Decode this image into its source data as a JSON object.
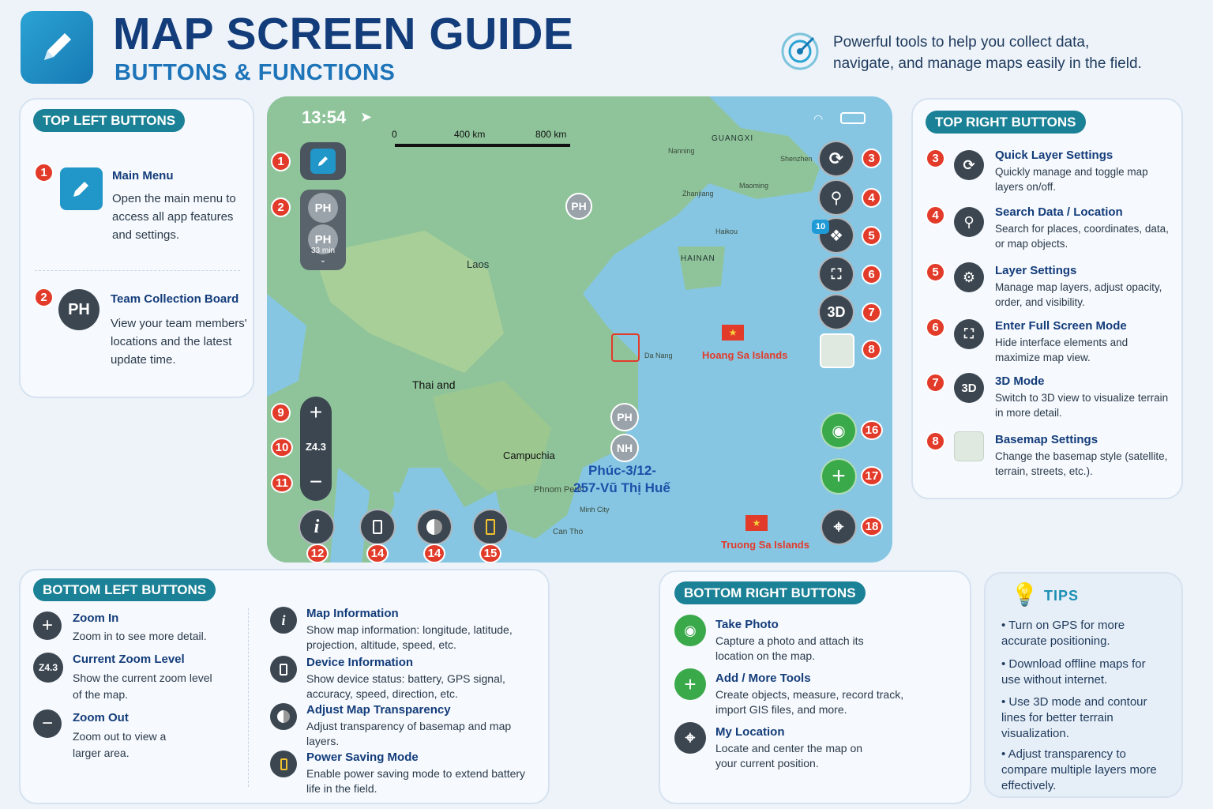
{
  "header": {
    "title": "MAP SCREEN GUIDE",
    "subtitle": "BUTTONS & FUNCTIONS",
    "tagline_1": "Powerful tools to help you collect data,",
    "tagline_2": "navigate, and manage maps easily in the field."
  },
  "top_left": {
    "pill": "TOP LEFT BUTTONS",
    "items": [
      {
        "num": "1",
        "title": "Main Menu",
        "desc": "Open the main menu to access all app features and settings."
      },
      {
        "num": "2",
        "icon_text": "PH",
        "title": "Team Collection Board",
        "desc": "View your team members' locations and the latest update time."
      }
    ]
  },
  "top_right": {
    "pill": "TOP RIGHT BUTTONS",
    "items": [
      {
        "num": "3",
        "title": "Quick Layer Settings",
        "desc": "Quickly manage and toggle map layers on/off."
      },
      {
        "num": "4",
        "title": "Search Data / Location",
        "desc": "Search for places, coordinates, data, or map objects."
      },
      {
        "num": "5",
        "title": "Layer Settings",
        "desc": "Manage map layers, adjust opacity, order, and visibility."
      },
      {
        "num": "6",
        "title": "Enter Full Screen Mode",
        "desc": "Hide interface elements and maximize map view."
      },
      {
        "num": "7",
        "icon_text": "3D",
        "title": "3D Mode",
        "desc": "Switch to 3D view to visualize terrain in more detail."
      },
      {
        "num": "8",
        "title": "Basemap Settings",
        "desc": "Change the basemap style (satellite, terrain, streets, etc.)."
      }
    ]
  },
  "bottom_left": {
    "pill": "BOTTOM LEFT BUTTONS",
    "items": [
      {
        "title": "Zoom In",
        "desc": "Zoom in to see more detail."
      },
      {
        "icon_text": "Z4.3",
        "title": "Current Zoom Level",
        "desc": "Show the current zoom level of the map."
      },
      {
        "title": "Zoom Out",
        "desc": "Zoom out to view a larger area."
      },
      {
        "title": "Map Information",
        "desc": "Show map information: longitude, latitude, projection, altitude, speed, etc."
      },
      {
        "title": "Device Information",
        "desc": "Show device status: battery, GPS signal, accuracy, speed, direction, etc."
      },
      {
        "title": "Adjust Map Transparency",
        "desc": "Adjust transparency of basemap and map layers."
      },
      {
        "title": "Power Saving Mode",
        "desc": "Enable power saving mode to extend battery life in the field."
      }
    ]
  },
  "bottom_right": {
    "pill": "BOTTOM RIGHT BUTTONS",
    "items": [
      {
        "title": "Take Photo",
        "desc": "Capture a photo and attach its location on the map."
      },
      {
        "title": "Add / More Tools",
        "desc": "Create objects, measure, record track, import GIS files, and more."
      },
      {
        "title": "My Location",
        "desc": "Locate and center the map on your current position."
      }
    ]
  },
  "tips": {
    "title": "TIPS",
    "items": [
      "Turn on GPS for more accurate positioning.",
      "Download offline maps for use without internet.",
      "Use 3D mode and contour lines for better terrain visualization.",
      "Adjust transparency to compare multiple layers more effectively."
    ]
  },
  "map": {
    "time": "13:54",
    "scale": [
      "0",
      "400 km",
      "800 km"
    ],
    "team_badges": [
      "PH",
      "PH"
    ],
    "team_time": "33 min",
    "zoom": "Z4.3",
    "layer_count": "10",
    "btn_3d": "3D",
    "labels": {
      "laos": "Laos",
      "thailand": "Thai and",
      "cambodia": "Campuchia",
      "hainan": "HAINAN",
      "guangxi": "GUANGXI",
      "nanning": "Nanning",
      "shenzhen": "Shenzhen",
      "zhanjiang": "Zhanjiang",
      "maoming": "Maoming",
      "haikou": "Haikou",
      "danang": "Da Nang",
      "phnompenh": "Phnom Penh",
      "hcm": "Minh City",
      "cantho": "Can Tho",
      "hoangsa": "Hoang Sa Islands",
      "truongsa": "Truong Sa Islands",
      "nh": "NH",
      "place_1": "Phúc-3/12-",
      "place_2": "257-Vũ Thị Huế"
    },
    "badges": [
      "1",
      "2",
      "3",
      "4",
      "5",
      "6",
      "7",
      "8",
      "9",
      "10",
      "11",
      "12",
      "14",
      "14",
      "15",
      "16",
      "17",
      "18"
    ]
  },
  "colors": {
    "title": "#133c7a",
    "accent": "#1b8196",
    "badge": "#e23b2a",
    "green": "#3aa94a"
  }
}
